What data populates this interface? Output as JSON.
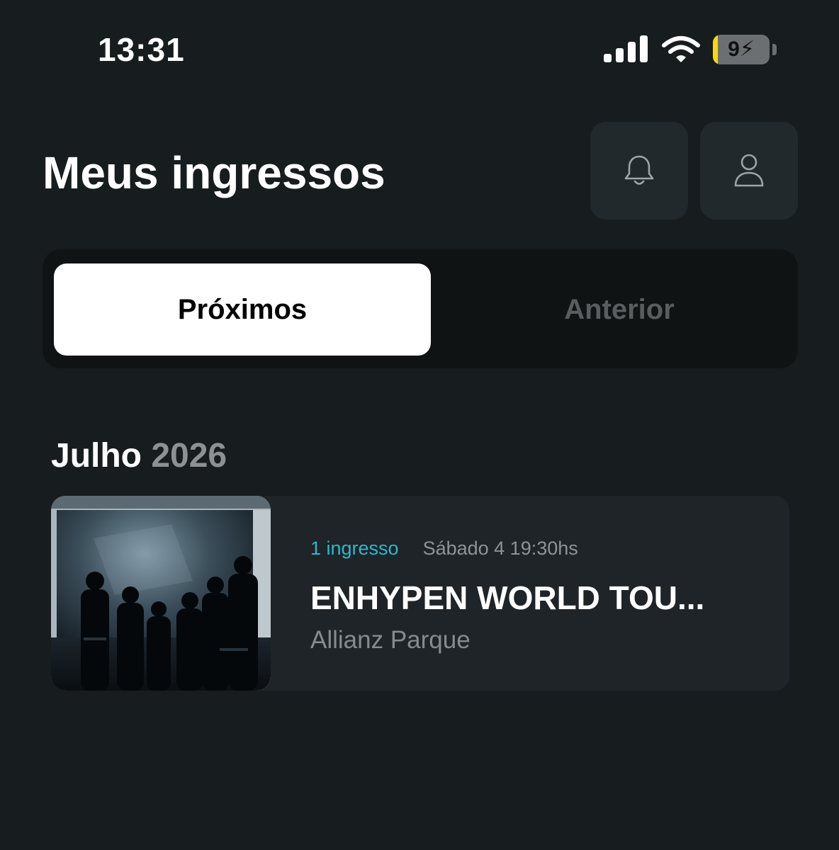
{
  "status_bar": {
    "time": "13:31",
    "battery_text": "9",
    "battery_level": 0.09,
    "battery_color": "#f5d90a",
    "icons": [
      "cellular-signal-icon",
      "wifi-icon",
      "battery-charging-icon"
    ]
  },
  "header": {
    "title": "Meus ingressos",
    "actions": [
      {
        "name": "notifications",
        "icon": "bell-icon"
      },
      {
        "name": "profile",
        "icon": "user-icon"
      }
    ]
  },
  "tabs": [
    {
      "label": "Próximos",
      "selected": true
    },
    {
      "label": "Anterior",
      "selected": false
    }
  ],
  "sections": [
    {
      "month": "Julho",
      "year": "2026",
      "tickets": [
        {
          "count_label": "1 ingresso",
          "date_label": "Sábado 4 19:30hs",
          "title": "ENHYPEN WORLD TOU...",
          "venue": "Allianz Parque"
        }
      ]
    }
  ],
  "colors": {
    "background": "#171c1f",
    "accent": "#2fb7cc",
    "card": "#1e2427"
  }
}
